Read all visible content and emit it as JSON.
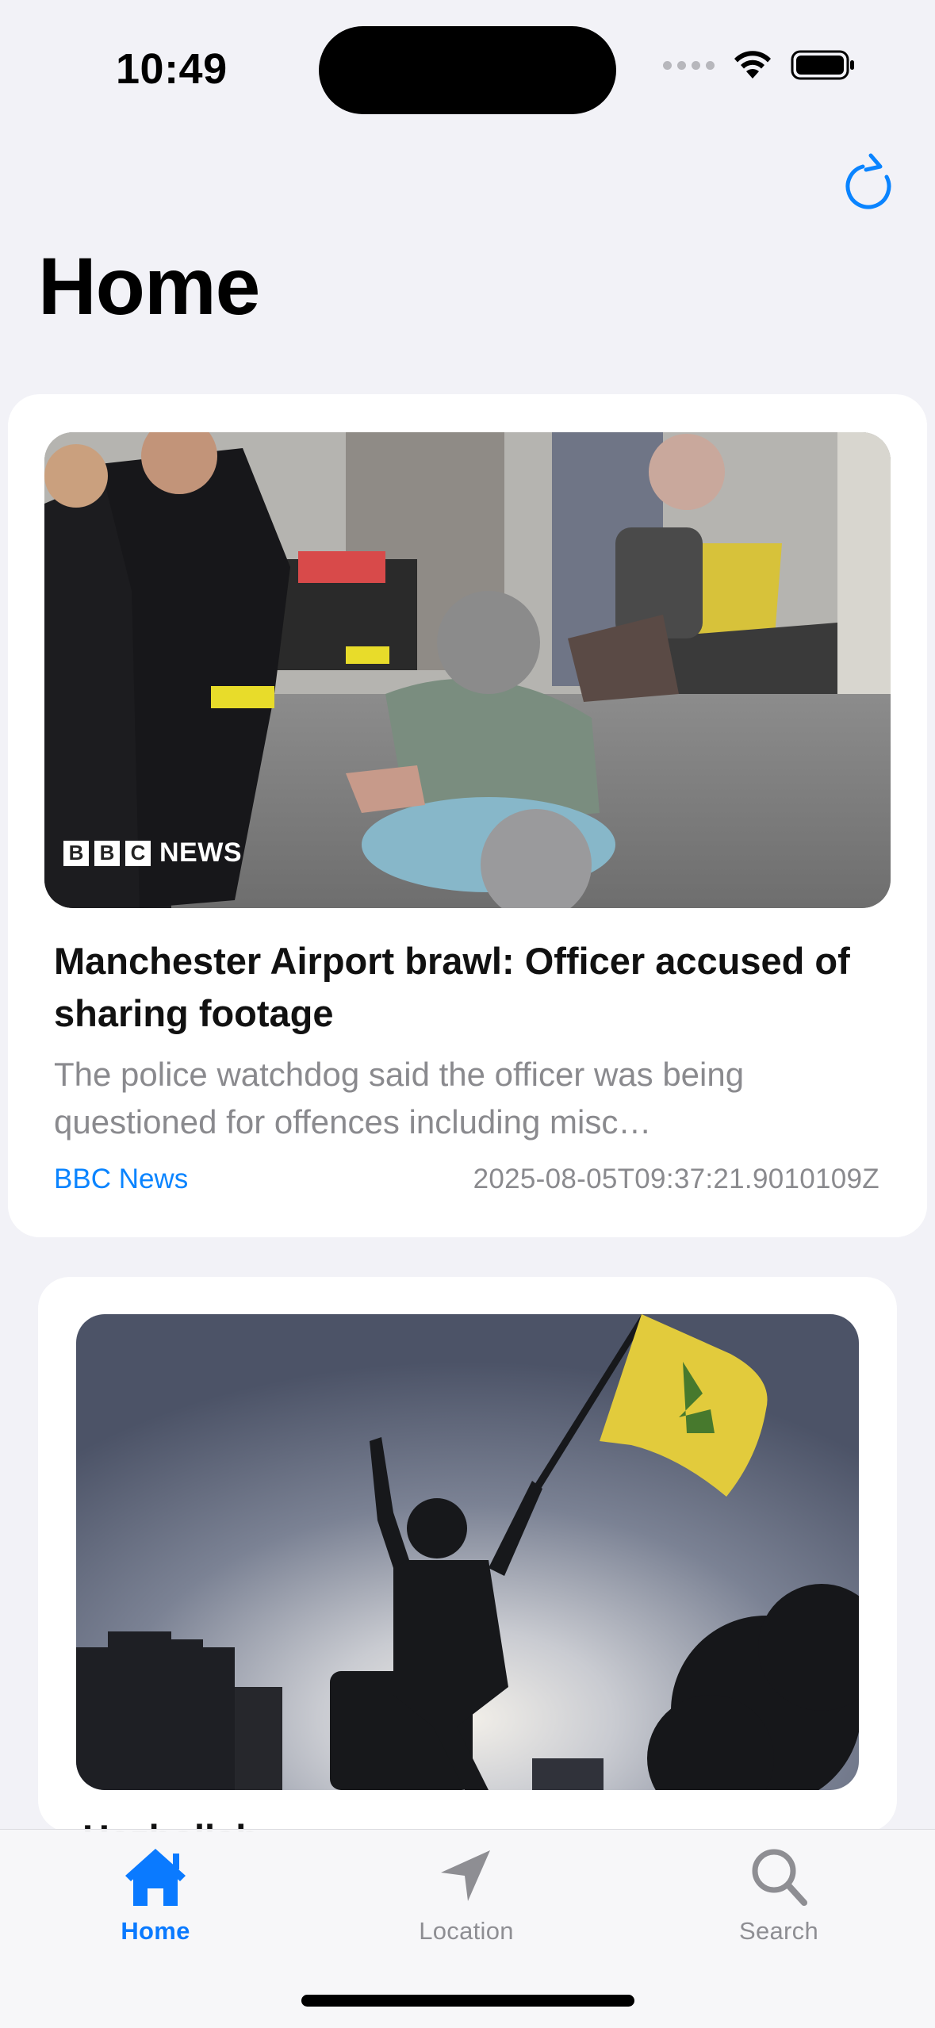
{
  "status_bar": {
    "time": "10:49",
    "icons": [
      "signal-dots-icon",
      "wifi-icon",
      "battery-icon"
    ]
  },
  "header": {
    "title": "Home",
    "refresh_icon": "refresh-icon",
    "accent_color": "#0A84FF"
  },
  "articles": [
    {
      "image_overlay_logo": "BBC NEWS",
      "title": "Manchester Airport brawl: Officer accused of sharing footage",
      "summary": "The police watchdog said the officer was being questioned for offences including misc…",
      "source": "BBC News",
      "published": "2025-08-05T09:37:21.9010109Z"
    },
    {
      "title": "Hezbollah"
    }
  ],
  "tab_bar": {
    "selected": "Home",
    "tabs": [
      {
        "label": "Home",
        "icon": "house-icon"
      },
      {
        "label": "Location",
        "icon": "location-arrow-icon"
      },
      {
        "label": "Search",
        "icon": "magnifier-icon"
      }
    ]
  }
}
